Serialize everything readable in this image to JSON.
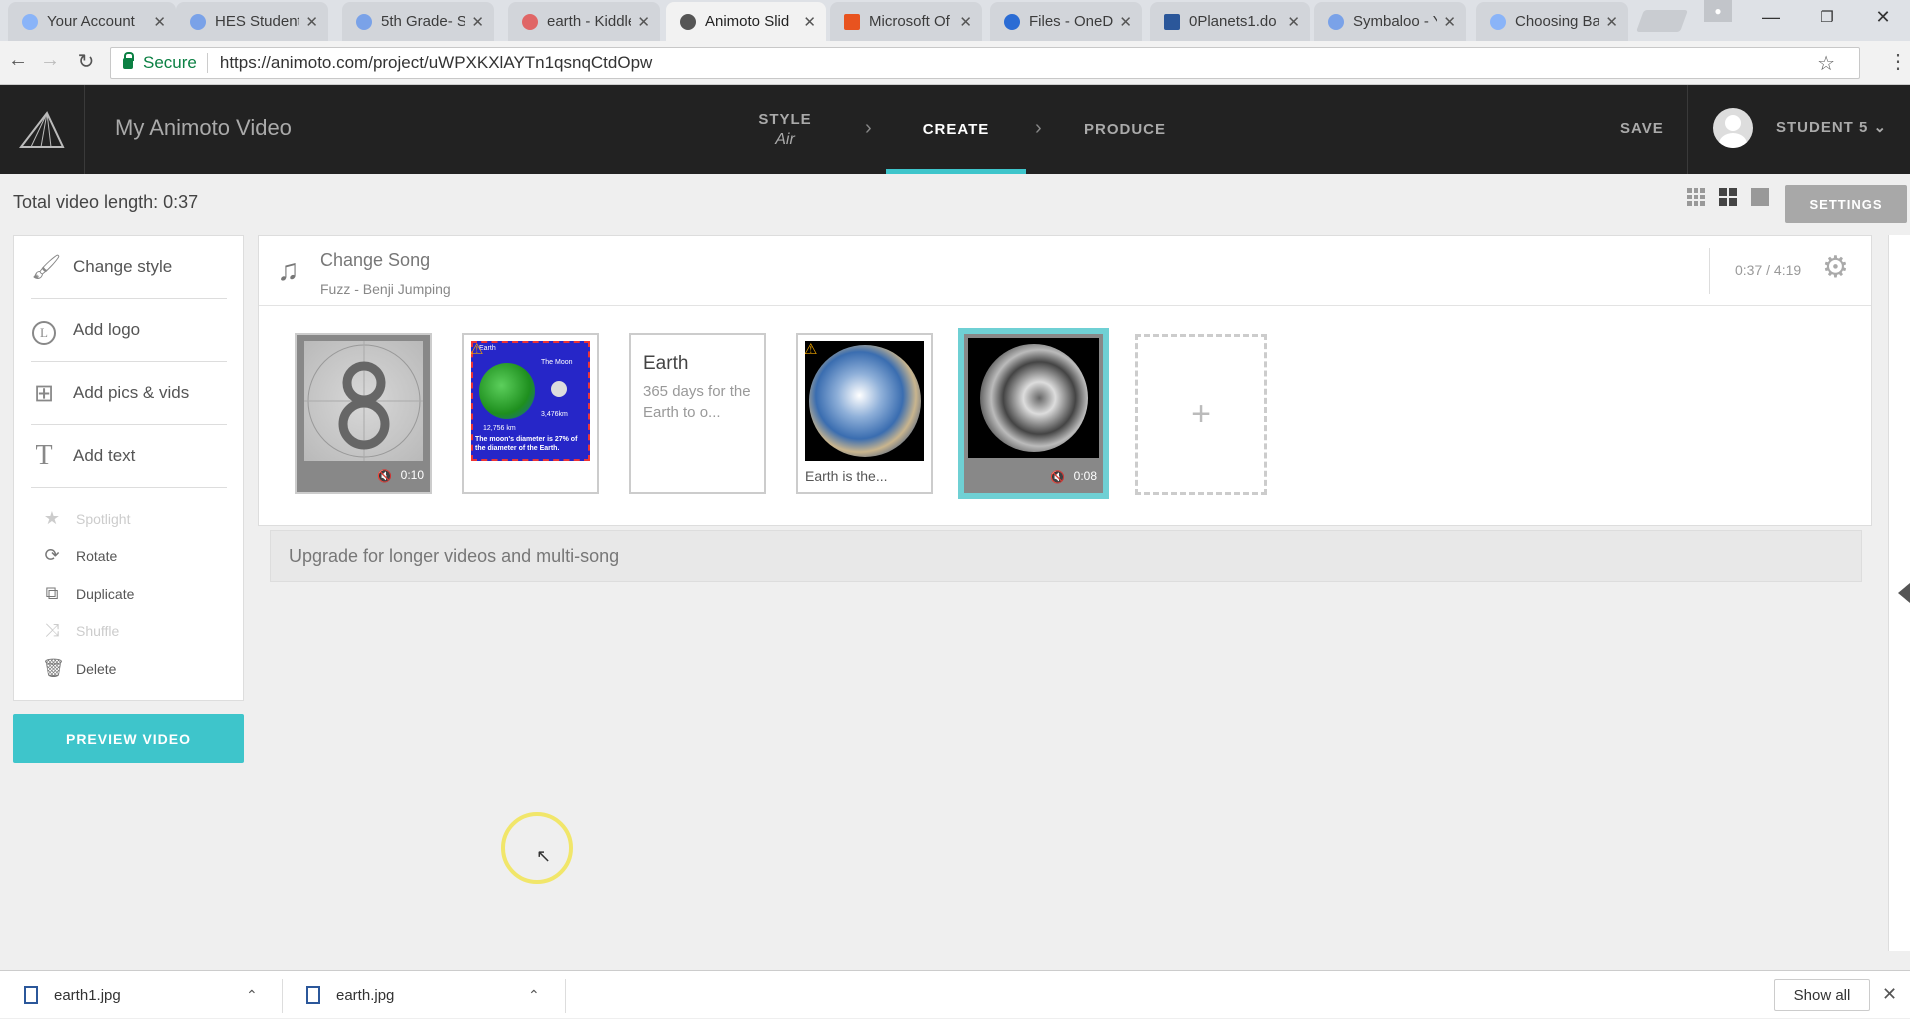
{
  "browser": {
    "tabs": [
      {
        "title": "Your Account",
        "favicon_color": "#8ab4f8"
      },
      {
        "title": "HES Student",
        "favicon_color": "#7aa2e8"
      },
      {
        "title": "5th Grade- S",
        "favicon_color": "#7aa2e8"
      },
      {
        "title": "earth - Kiddle",
        "favicon_color": "#e06666"
      },
      {
        "title": "Animoto Slid",
        "favicon_color": "#555555"
      },
      {
        "title": "Microsoft Of",
        "favicon_color": "#e8531f"
      },
      {
        "title": "Files - OneDr",
        "favicon_color": "#2b6cd4"
      },
      {
        "title": "0Planets1.do",
        "favicon_color": "#2b579a"
      },
      {
        "title": "Symbaloo - Y",
        "favicon_color": "#7aa2e8"
      },
      {
        "title": "Choosing Ba",
        "favicon_color": "#8ab4f8"
      }
    ],
    "active_tab_index": 4,
    "secure_label": "Secure",
    "url": "https://animoto.com/project/uWPXKXlAYTn1qsnqCtdOpw"
  },
  "app": {
    "project_title": "My Animoto Video",
    "steps": [
      {
        "label": "STYLE",
        "sub": "Air"
      },
      {
        "label": "CREATE",
        "sub": ""
      },
      {
        "label": "PRODUCE",
        "sub": ""
      }
    ],
    "save_label": "SAVE",
    "user_label": "STUDENT 5",
    "accent_color": "#3ec5cb"
  },
  "toolbar": {
    "total_length": "Total video length: 0:37",
    "settings_label": "SETTINGS"
  },
  "sidebar": {
    "items": [
      {
        "label": "Change style",
        "icon": "brush-icon"
      },
      {
        "label": "Add logo",
        "icon": "logo-icon"
      },
      {
        "label": "Add pics & vids",
        "icon": "add-media-icon"
      },
      {
        "label": "Add text",
        "icon": "text-icon"
      }
    ],
    "actions": [
      {
        "label": "Spotlight",
        "icon": "star-icon",
        "enabled": false
      },
      {
        "label": "Rotate",
        "icon": "rotate-icon",
        "enabled": true
      },
      {
        "label": "Duplicate",
        "icon": "duplicate-icon",
        "enabled": true
      },
      {
        "label": "Shuffle",
        "icon": "shuffle-icon",
        "enabled": false
      },
      {
        "label": "Delete",
        "icon": "trash-icon",
        "enabled": true
      }
    ],
    "preview_label": "PREVIEW VIDEO"
  },
  "song": {
    "title": "Change Song",
    "name": "Fuzz - Benji Jumping",
    "time": "0:37 / 4:19"
  },
  "blocks": [
    {
      "kind": "video",
      "duration": "0:10"
    },
    {
      "kind": "image-warning",
      "image_text_top": "Earth",
      "image_text_right": "The Moon",
      "image_km1": "12,756 km",
      "image_km2": "3,476km",
      "image_note": "The moon's diameter is 27% of the diameter of the Earth."
    },
    {
      "kind": "text",
      "heading": "Earth",
      "body": "365 days for the Earth to o..."
    },
    {
      "kind": "image-caption",
      "caption": "Earth is the..."
    },
    {
      "kind": "video-selected",
      "duration": "0:08"
    }
  ],
  "add_slot_symbol": "+",
  "upgrade_text": "Upgrade for longer videos and multi-song",
  "downloads": {
    "files": [
      "earth1.jpg",
      "earth.jpg"
    ],
    "show_all": "Show all"
  }
}
